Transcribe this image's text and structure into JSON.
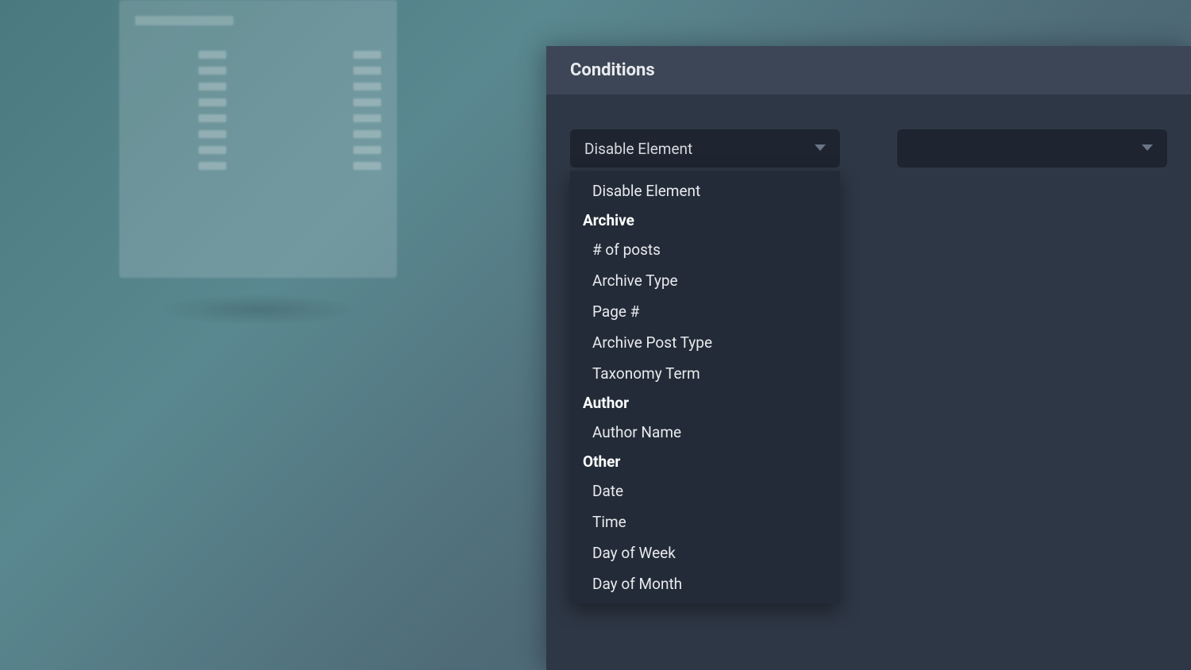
{
  "panel": {
    "title": "Conditions"
  },
  "select": {
    "selected": "Disable Element",
    "options": {
      "top": "Disable Element",
      "group1": {
        "label": "Archive",
        "items": [
          "# of posts",
          "Archive Type",
          "Page #",
          "Archive Post Type",
          "Taxonomy Term"
        ]
      },
      "group2": {
        "label": "Author",
        "items": [
          "Author Name"
        ]
      },
      "group3": {
        "label": "Other",
        "items": [
          "Date",
          "Time",
          "Day of Week",
          "Day of Month"
        ]
      }
    }
  }
}
